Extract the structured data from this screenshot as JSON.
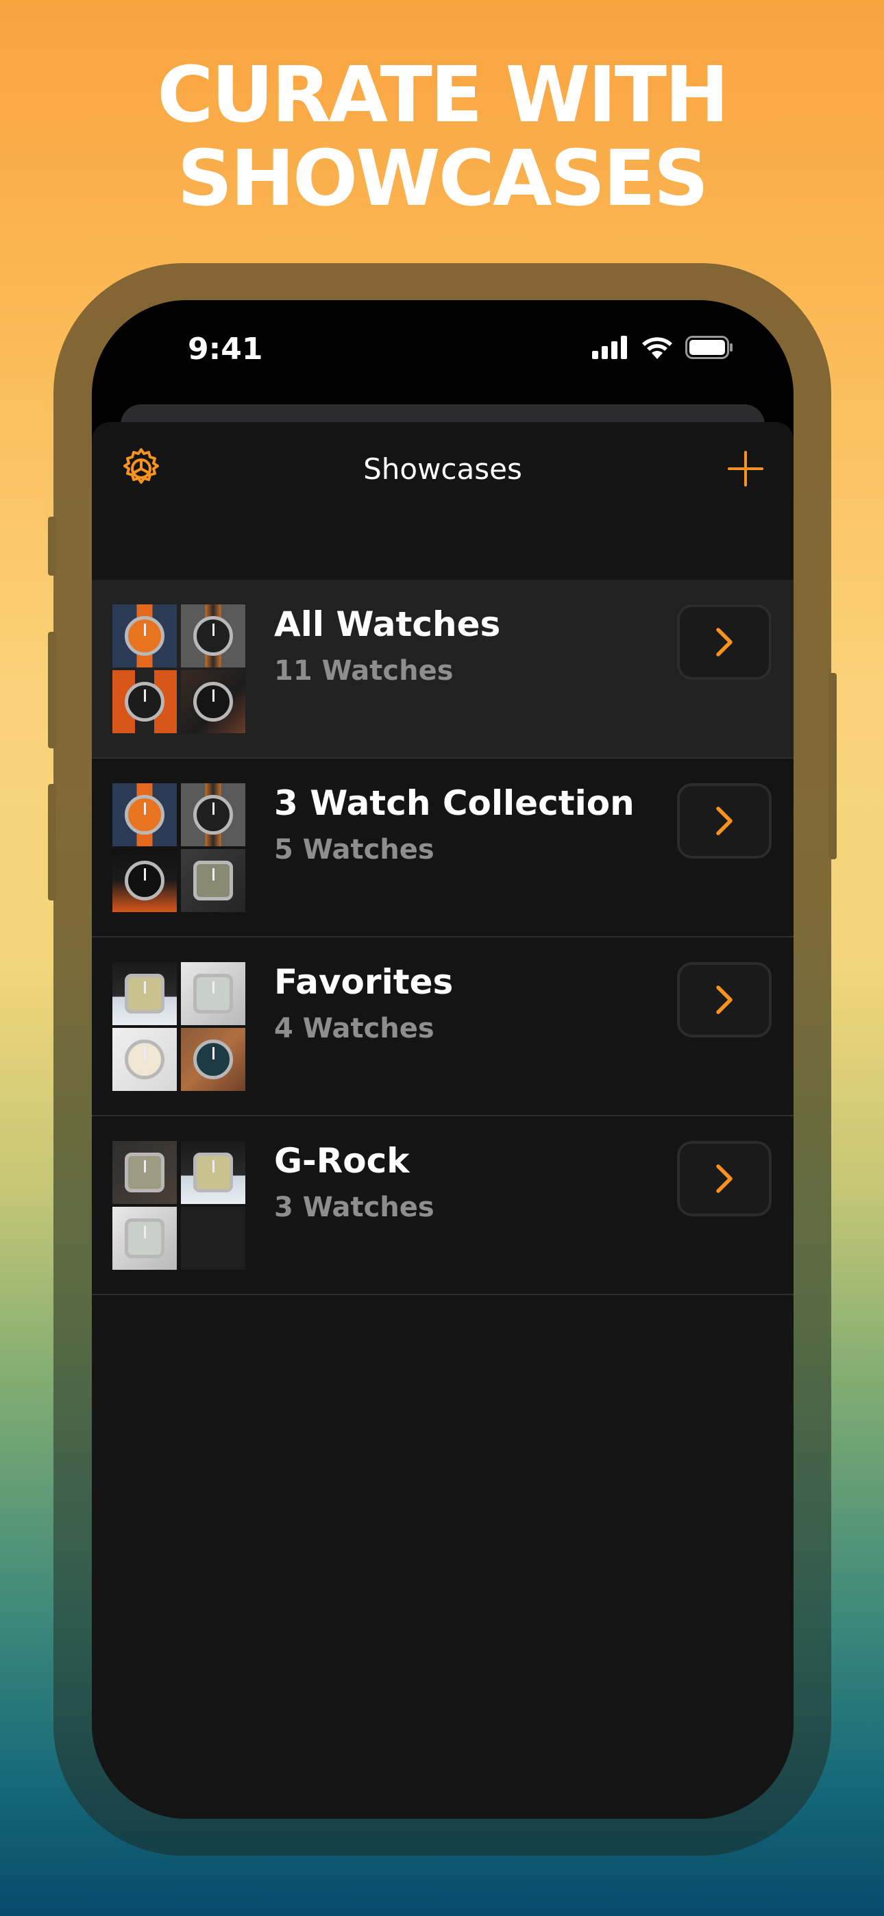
{
  "headline": {
    "line1": "CURATE WITH",
    "line2": "SHOWCASES"
  },
  "status_bar": {
    "time": "9:41"
  },
  "nav": {
    "title": "Showcases"
  },
  "colors": {
    "accent": "#f7931e",
    "sheet_bg": "#141414",
    "row_selected": "#212121",
    "subtext": "#8e8e8e"
  },
  "showcases": [
    {
      "title": "All Watches",
      "count": "11 Watches",
      "selected": true,
      "thumbs": [
        {
          "bg": "linear-gradient(90deg,#2c3b55 0%,#2c3b55 38%,#e4691e 38%,#e4691e 62%,#2c3b55 62%)",
          "face": "#e8741f",
          "square": false
        },
        {
          "bg": "linear-gradient(90deg,#5a5a5a 0%,#5a5a5a 38%,#c26b24 38%,#2b2b2b 50%,#c26b24 62%,#5a5a5a 62%)",
          "face": "#1f1f1f",
          "square": false
        },
        {
          "bg": "linear-gradient(90deg,#d9561b 0%,#d9561b 35%,#222 35%,#222 65%,#d9561b 65%)",
          "face": "#1c1c1c",
          "square": false
        },
        {
          "bg": "linear-gradient(135deg,#3a2a25 0%,#1c1c1c 60%,#6b3b2a 100%)",
          "face": "#151515",
          "square": false
        }
      ]
    },
    {
      "title": "3 Watch Collection",
      "count": "5 Watches",
      "selected": false,
      "thumbs": [
        {
          "bg": "linear-gradient(90deg,#2c3b55 0%,#2c3b55 38%,#e4691e 38%,#e4691e 62%,#2c3b55 62%)",
          "face": "#e8741f",
          "square": false
        },
        {
          "bg": "linear-gradient(90deg,#5a5a5a 0%,#5a5a5a 38%,#c26b24 38%,#2b2b2b 50%,#c26b24 62%,#5a5a5a 62%)",
          "face": "#1f1f1f",
          "square": false
        },
        {
          "bg": "linear-gradient(180deg,#111 0%,#1b1b1b 50%,#d9561b 100%)",
          "face": "#101010",
          "square": false
        },
        {
          "bg": "linear-gradient(135deg,#3b3b3b 0%,#242424 100%)",
          "face": "#8a8a73",
          "square": true
        }
      ]
    },
    {
      "title": "Favorites",
      "count": "4 Watches",
      "selected": false,
      "thumbs": [
        {
          "bg": "linear-gradient(180deg,#1a1a1a 0%,#2a2a2a 55%,#cfd6e0 55%,#e9edf2 100%)",
          "face": "#c9c28e",
          "square": true
        },
        {
          "bg": "linear-gradient(135deg,#e8e8e8 0%,#b9b9b9 100%)",
          "face": "#c9cfc9",
          "square": true
        },
        {
          "bg": "linear-gradient(135deg,#f0f0f0 0%,#d8d8d8 100%)",
          "face": "#efe7d3",
          "square": false
        },
        {
          "bg": "linear-gradient(135deg,#8a5a3a 0%,#b06e40 50%,#6e4128 100%)",
          "face": "#1d3b45",
          "square": false
        }
      ]
    },
    {
      "title": "G-Rock",
      "count": "3 Watches",
      "selected": false,
      "thumbs": [
        {
          "bg": "linear-gradient(135deg,#2e2e2e 0%,#4a4038 100%)",
          "face": "#9d9c83",
          "square": true
        },
        {
          "bg": "linear-gradient(180deg,#1a1a1a 0%,#2a2a2a 55%,#cfd6e0 55%,#e9edf2 100%)",
          "face": "#c9c28e",
          "square": true
        },
        {
          "bg": "linear-gradient(135deg,#e8e8e8 0%,#b9b9b9 100%)",
          "face": "#c9cfc9",
          "square": true
        },
        {
          "bg": "#1e1e1e",
          "face": "",
          "square": false
        }
      ]
    }
  ]
}
